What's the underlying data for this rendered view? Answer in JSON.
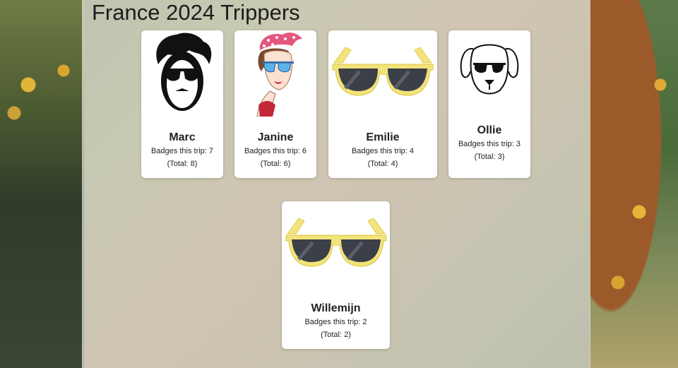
{
  "page": {
    "title": "France 2024 Trippers"
  },
  "trippers": [
    {
      "name": "Marc",
      "badges_text": "Badges this trip: 7",
      "total_text": "(Total: 8)",
      "avatar": "boy-sunglasses-icon"
    },
    {
      "name": "Janine",
      "badges_text": "Badges this trip: 6",
      "total_text": "(Total: 6)",
      "avatar": "pinup-girl-sunglasses-icon"
    },
    {
      "name": "Emilie",
      "badges_text": "Badges this trip: 4",
      "total_text": "(Total: 4)",
      "avatar": "yellow-sunglasses-icon"
    },
    {
      "name": "Ollie",
      "badges_text": "Badges this trip: 3",
      "total_text": "(Total: 3)",
      "avatar": "dog-sunglasses-icon"
    },
    {
      "name": "Willemijn",
      "badges_text": "Badges this trip: 2",
      "total_text": "(Total: 2)",
      "avatar": "yellow-sunglasses-icon"
    }
  ],
  "colors": {
    "frame_yellow": "#f2e37a",
    "lens": "#3b3f48",
    "accent_pink": "#e4577d"
  }
}
